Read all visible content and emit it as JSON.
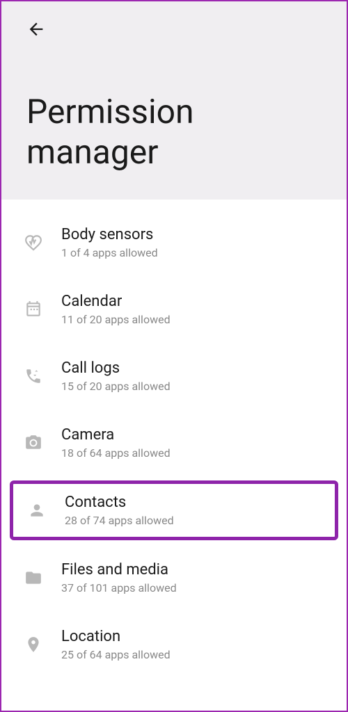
{
  "header": {
    "title": "Permission manager"
  },
  "permissions": [
    {
      "label": "Body sensors",
      "status": "1 of 4 apps allowed",
      "highlighted": false
    },
    {
      "label": "Calendar",
      "status": "11 of 20 apps allowed",
      "highlighted": false
    },
    {
      "label": "Call logs",
      "status": "15 of 20 apps allowed",
      "highlighted": false
    },
    {
      "label": "Camera",
      "status": "18 of 64 apps allowed",
      "highlighted": false
    },
    {
      "label": "Contacts",
      "status": "28 of 74 apps allowed",
      "highlighted": true
    },
    {
      "label": "Files and media",
      "status": "37 of 101 apps allowed",
      "highlighted": false
    },
    {
      "label": "Location",
      "status": "25 of 64 apps allowed",
      "highlighted": false
    }
  ]
}
